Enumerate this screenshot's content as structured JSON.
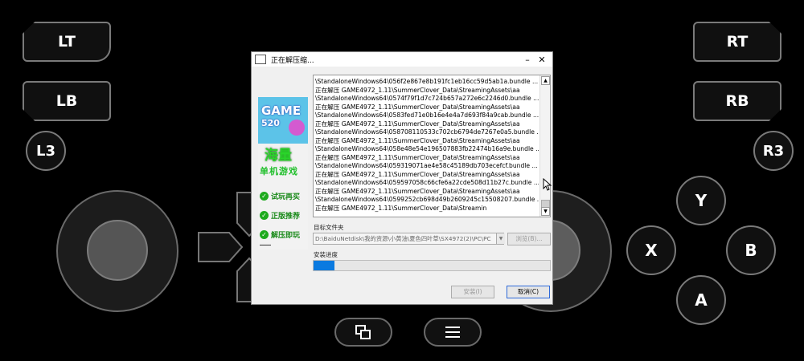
{
  "gamepad": {
    "lt": "LT",
    "lb": "LB",
    "l3": "L3",
    "rt": "RT",
    "rb": "RB",
    "r3": "R3",
    "y": "Y",
    "x": "X",
    "b": "B",
    "a": "A",
    "center_left_icon": "window-switch-icon",
    "center_right_icon": "menu-icon"
  },
  "dialog": {
    "title": "正在解压缩...",
    "minimize": "–",
    "close": "✕",
    "banner": {
      "logo_text": "GAME",
      "logo_num": "520",
      "headline": "海量",
      "subline": "单机游戏",
      "badges": [
        "试玩再买",
        "正版推荐",
        "解压即玩"
      ]
    },
    "log_lines": [
      "\\StandaloneWindows64\\056f2e867e8b191fc1eb16cc59d5ab1a.bundle  ...",
      "正在解压 GAME4972_1.11\\SummerClover_Data\\StreamingAssets\\aa",
      "\\StandaloneWindows64\\0574f79f1d7c724b657a272e6c2246d0.bundle  ...",
      "正在解压 GAME4972_1.11\\SummerClover_Data\\StreamingAssets\\aa",
      "\\StandaloneWindows64\\0583fed71e0b16e4e4a7d693f84a9cab.bundle  ...",
      "正在解压 GAME4972_1.11\\SummerClover_Data\\StreamingAssets\\aa",
      "\\StandaloneWindows64\\058708110533c702cb6794de7267e0a5.bundle  ...",
      "正在解压 GAME4972_1.11\\SummerClover_Data\\StreamingAssets\\aa",
      "\\StandaloneWindows64\\058e48e54e196507883fb22474b16a9e.bundle  ...",
      "正在解压 GAME4972_1.11\\SummerClover_Data\\StreamingAssets\\aa",
      "\\StandaloneWindows64\\059319071ae4e58c45189db703ecefcf.bundle  ...",
      "正在解压 GAME4972_1.11\\SummerClover_Data\\StreamingAssets\\aa",
      "\\StandaloneWindows64\\059597058c66cfe6a22cde508d11b27c.bundle  ...",
      "正在解压 GAME4972_1.11\\SummerClover_Data\\StreamingAssets\\aa",
      "\\StandaloneWindows64\\0599252cb698d49b2609245c15508207.bundle  ...",
      "正在解压 GAME4972_1.11\\SummerClover_Data\\Streamin"
    ],
    "target_folder_label": "目标文件夹",
    "target_path": "D:\\BaiduNetdisk\\我的资源\\小黄油\\夏色四叶草\\SX4972(2)\\PC\\PC",
    "browse_label": "浏览(B)...",
    "progress_label": "安装进度",
    "progress_value": 0.09,
    "install_label": "安装(I)",
    "cancel_label": "取消(C)"
  }
}
